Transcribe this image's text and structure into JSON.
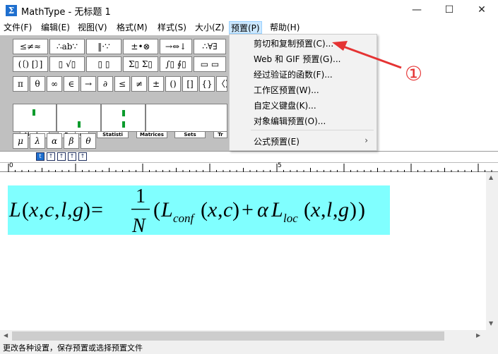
{
  "window": {
    "title": "MathType - 无标题 1",
    "icon": "Σ"
  },
  "window_buttons": {
    "minimize": "—",
    "maximize": "☐",
    "close": "✕"
  },
  "menubar": {
    "items": [
      "文件(F)",
      "编辑(E)",
      "视图(V)",
      "格式(M)",
      "样式(S)",
      "大小(Z)",
      "预置(P)",
      "帮助(H)"
    ],
    "active": "预置(P)"
  },
  "palette": {
    "row1": [
      "≤≠≈",
      "∴ab∵",
      "‖·∵",
      "±•⊗",
      "→⇔↓",
      "∴∀∃",
      "∉∩⊂"
    ],
    "row2": [
      "(〔) [〕]",
      "▯ √▯",
      "▯ ▯",
      "Σ▯ Σ▯",
      "∫▯ ∮▯",
      "▭ ▭",
      "→ ←"
    ],
    "row3": [
      "π",
      "θ",
      "∞",
      "∈",
      "→",
      "∂",
      "≤",
      "≠",
      "±",
      "()",
      "[]",
      "{}",
      "〈〉"
    ],
    "tabs": [
      "Algebra",
      "Derivs",
      "Statisti",
      "Matrices",
      "Sets",
      "Tr"
    ],
    "greek": [
      "μ",
      "λ",
      "α",
      "β",
      "θ"
    ]
  },
  "preferences_menu": {
    "items": [
      "剪切和复制预置(C)...",
      "Web 和 GIF 预置(G)...",
      "经过验证的函数(F)...",
      "工作区预置(W)...",
      "自定义键盘(K)...",
      "对象编辑预置(O)...",
      "公式预置(E)"
    ],
    "submenu_arrow": "›"
  },
  "annotation": {
    "marker": "①",
    "color": "#e53333"
  },
  "size_buttons": [
    "t",
    "↑",
    "↑",
    "↑",
    "↑"
  ],
  "ruler": {
    "labels": [
      "0",
      "5"
    ]
  },
  "equation": {
    "latex": "L(x,c,l,g)=\\frac{1}{N}(L_{conf}(x,c)+\\alpha L_{loc}(x,l,g))",
    "highlight_color": "#80ffff"
  },
  "statusbar": {
    "text": "更改各种设置，保存预置或选择预置文件"
  }
}
